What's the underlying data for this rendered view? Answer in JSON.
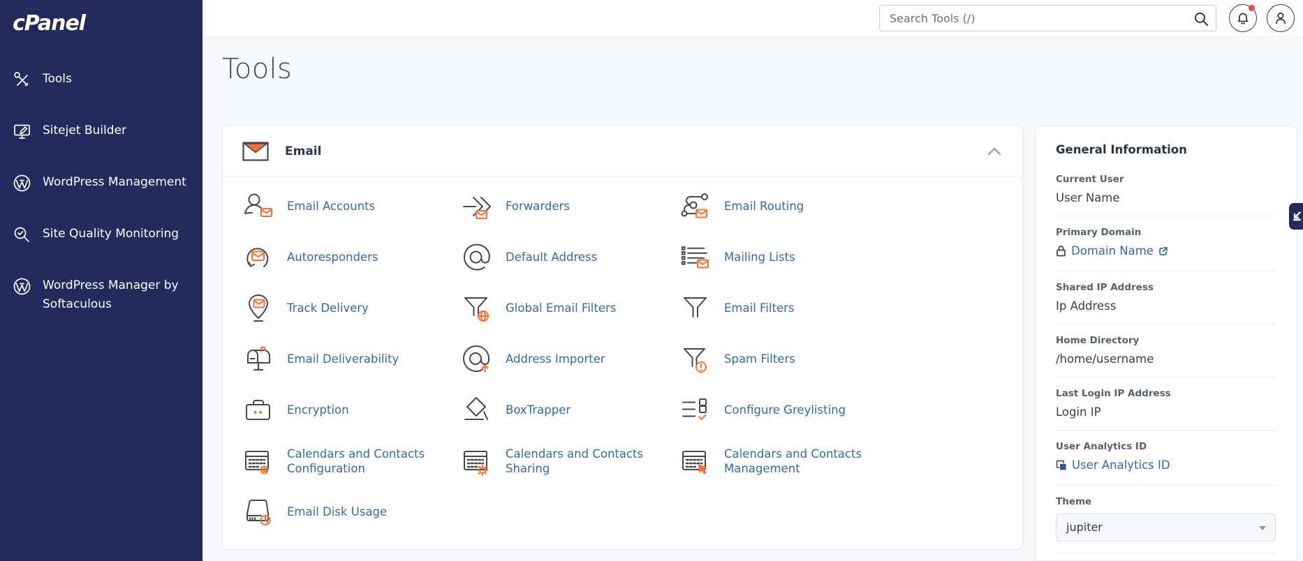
{
  "app": {
    "logo_text": "cPanel"
  },
  "sidebar": {
    "items": [
      {
        "label": "Tools",
        "icon": "tools-icon"
      },
      {
        "label": "Sitejet Builder",
        "icon": "sitejet-icon"
      },
      {
        "label": "WordPress Management",
        "icon": "wordpress-icon"
      },
      {
        "label": "Site Quality Monitoring",
        "icon": "site-quality-icon"
      },
      {
        "label": "WordPress Manager by Softaculous",
        "icon": "wordpress-icon"
      }
    ]
  },
  "topbar": {
    "search_placeholder": "Search Tools (/)",
    "has_notification": true
  },
  "page": {
    "title": "Tools"
  },
  "email_section": {
    "title": "Email",
    "collapsed": false,
    "tools": [
      {
        "label": "Email Accounts"
      },
      {
        "label": "Forwarders"
      },
      {
        "label": "Email Routing"
      },
      {
        "label": "Autoresponders"
      },
      {
        "label": "Default Address"
      },
      {
        "label": "Mailing Lists"
      },
      {
        "label": "Track Delivery"
      },
      {
        "label": "Global Email Filters"
      },
      {
        "label": "Email Filters"
      },
      {
        "label": "Email Deliverability"
      },
      {
        "label": "Address Importer"
      },
      {
        "label": "Spam Filters"
      },
      {
        "label": "Encryption"
      },
      {
        "label": "BoxTrapper"
      },
      {
        "label": "Configure Greylisting"
      },
      {
        "label": "Calendars and Contacts Configuration"
      },
      {
        "label": "Calendars and Contacts Sharing"
      },
      {
        "label": "Calendars and Contacts Management"
      },
      {
        "label": "Email Disk Usage"
      }
    ]
  },
  "general_info": {
    "title": "General Information",
    "rows": [
      {
        "label": "Current User",
        "value": "User Name"
      },
      {
        "label": "Primary Domain",
        "value": "Domain Name"
      },
      {
        "label": "Shared IP Address",
        "value": "Ip Address"
      },
      {
        "label": "Home Directory",
        "value": "/home/username"
      },
      {
        "label": "Last Login IP Address",
        "value": "Login IP"
      },
      {
        "label": "User Analytics ID",
        "value": "User Analytics ID"
      },
      {
        "label": "Theme",
        "value": "jupiter"
      }
    ]
  },
  "colors": {
    "sidebar_bg": "#242a5c",
    "accent_orange": "#ff6c2c",
    "link_blue": "#2f6bb3",
    "notification_red": "#e5484d"
  }
}
